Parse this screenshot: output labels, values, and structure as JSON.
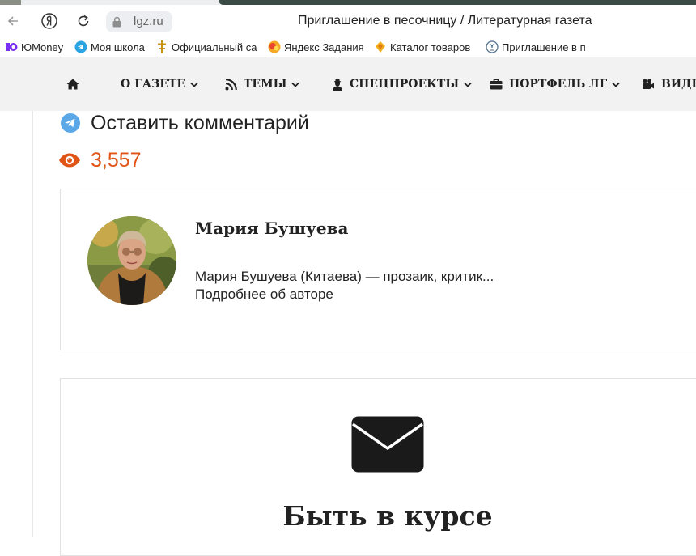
{
  "browser": {
    "domain": "lgz.ru",
    "page_title": "Приглашение в песочницу / Литературная газета",
    "nav_buttons": [
      "back-icon",
      "yandex-icon",
      "reload-icon"
    ]
  },
  "bookmarks": [
    {
      "label": "ЮMoney",
      "icon": "yumoney-icon"
    },
    {
      "label": "Моя школа",
      "icon": "telegram-icon"
    },
    {
      "label": "Официальный са",
      "icon": "cross-icon"
    },
    {
      "label": "Яндекс Задания",
      "icon": "yandex-tasks-icon"
    },
    {
      "label": "Каталог товаров",
      "icon": "catalog-icon"
    },
    {
      "label": "Приглашение в п",
      "icon": "lgz-icon"
    }
  ],
  "site_nav": {
    "home_icon": "home-icon",
    "items": [
      {
        "label": "О ГАЗЕТЕ",
        "icon": null,
        "dropdown": true
      },
      {
        "label": "ТЕМЫ",
        "icon": "rss-icon",
        "dropdown": true
      },
      {
        "label": "СПЕЦПРОЕКТЫ",
        "icon": "user-secret-icon",
        "dropdown": true
      },
      {
        "label": "ПОРТФЕЛЬ ЛГ",
        "icon": "briefcase-icon",
        "dropdown": true
      },
      {
        "label": "ВИДЕ",
        "icon": "video-camera-icon",
        "dropdown": false
      }
    ]
  },
  "article_meta": {
    "comment_label": "Оставить комментарий",
    "views": "3,557"
  },
  "author": {
    "name": "Мария Бушуева",
    "bio": "Мария Бушуева (Китаева) — прозаик, критик...",
    "more_link": "Подробнее об авторе"
  },
  "subscribe": {
    "title": "Быть в курсе",
    "icon": "envelope-icon"
  },
  "colors": {
    "accent_orange": "#e05416",
    "telegram_blue": "#5ba8e8",
    "nav_bg": "#f2f2f2"
  }
}
